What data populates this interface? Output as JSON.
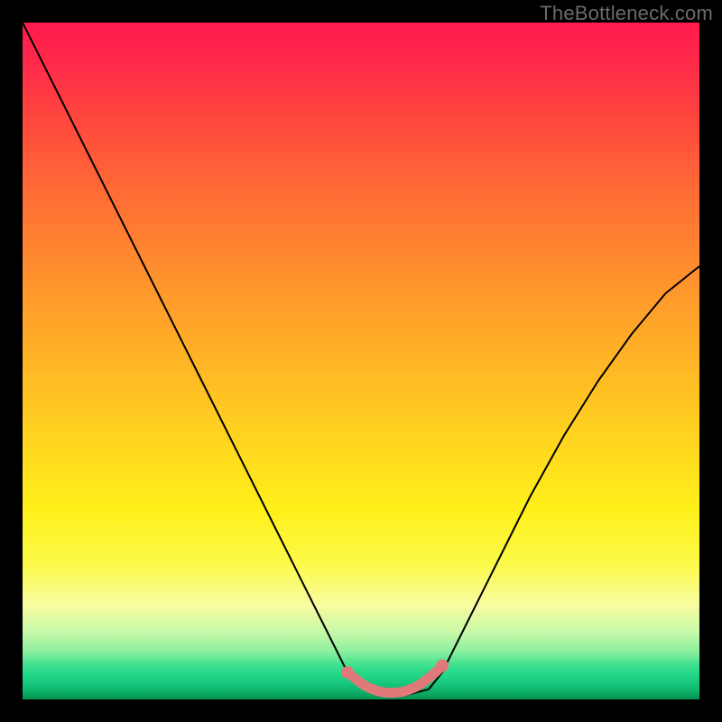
{
  "watermark": "TheBottleneck.com",
  "chart_data": {
    "type": "line",
    "title": "",
    "xlabel": "",
    "ylabel": "",
    "xlim": [
      0,
      100
    ],
    "ylim": [
      0,
      100
    ],
    "grid": false,
    "legend": false,
    "series": [
      {
        "name": "bottleneck-curve",
        "x": [
          0,
          5,
          10,
          15,
          20,
          25,
          30,
          35,
          40,
          45,
          48,
          50,
          52,
          54,
          56,
          58,
          60,
          62,
          65,
          70,
          75,
          80,
          85,
          90,
          95,
          100
        ],
        "values": [
          100,
          90,
          80,
          70,
          60,
          50,
          40,
          30,
          20,
          10,
          4,
          2,
          1,
          0.5,
          0.5,
          1,
          1.5,
          4,
          10,
          20,
          30,
          39,
          47,
          54,
          60,
          64
        ]
      }
    ],
    "accent_trough": {
      "name": "accent-dots",
      "color": "#e07a7a",
      "x": [
        48,
        49,
        50,
        51,
        52,
        53,
        54,
        55,
        56,
        57,
        58,
        59,
        60,
        61,
        62
      ],
      "values": [
        4,
        3.2,
        2.4,
        1.8,
        1.4,
        1.1,
        1.0,
        1.0,
        1.1,
        1.4,
        1.8,
        2.4,
        3.2,
        4.0,
        5.0
      ]
    },
    "gradient_stops": [
      {
        "pct": 0,
        "color": "#ff1a4d"
      },
      {
        "pct": 25,
        "color": "#ff6b35"
      },
      {
        "pct": 60,
        "color": "#ffd020"
      },
      {
        "pct": 86,
        "color": "#f8fca0"
      },
      {
        "pct": 96,
        "color": "#1fd688"
      },
      {
        "pct": 100,
        "color": "#068f50"
      }
    ]
  }
}
